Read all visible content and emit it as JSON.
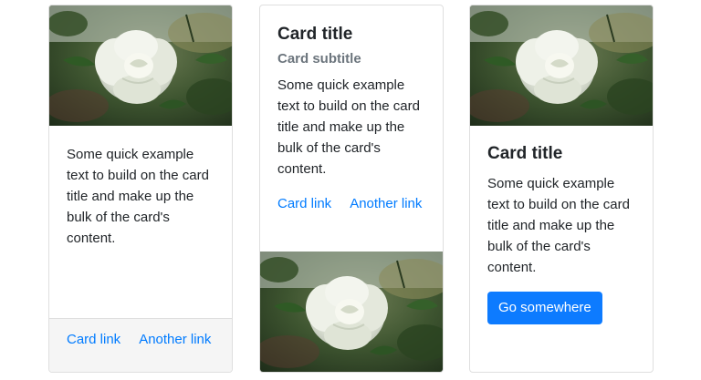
{
  "card1": {
    "image_alt": "white rose",
    "text": "Some quick example text to build on the card title and make up the bulk of the card's content.",
    "link1": "Card link",
    "link2": "Another link"
  },
  "card2": {
    "title": "Card title",
    "subtitle": "Card subtitle",
    "text": "Some quick example text to build on the card title and make up the bulk of the card's content.",
    "link1": "Card link",
    "link2": "Another link",
    "image_alt": "white rose"
  },
  "card3": {
    "image_alt": "white rose",
    "title": "Card title",
    "text": "Some quick example text to build on the card title and make up the bulk of the card's content.",
    "button": "Go somewhere"
  },
  "colors": {
    "link": "#007bff",
    "button": "#0d7bff",
    "subtitle": "#6c757d",
    "footer_bg": "#f5f5f5"
  }
}
